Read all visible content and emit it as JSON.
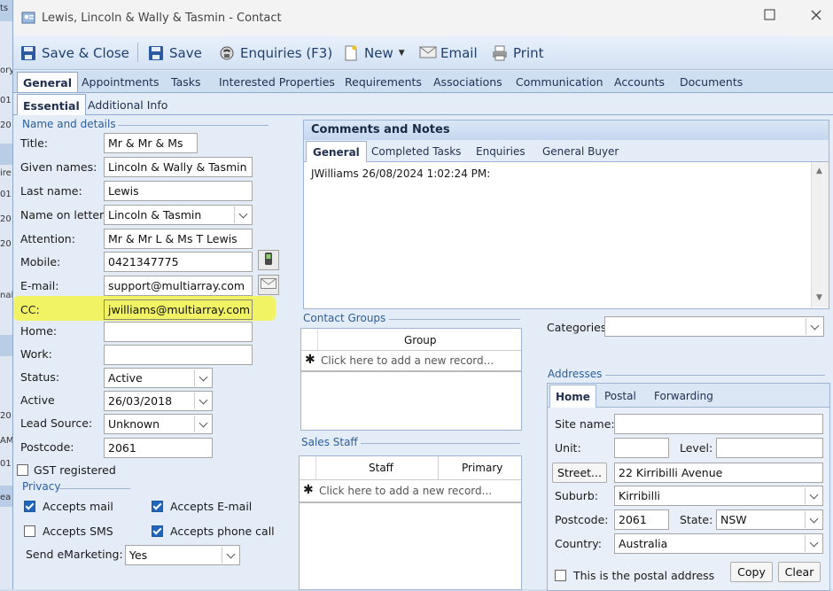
{
  "window": {
    "title": "Lewis, Lincoln & Wally & Tasmin - Contact"
  },
  "background": {
    "cells": [
      "ts",
      "ory",
      "01",
      "20",
      "ire",
      "01",
      "20",
      "20",
      "nal",
      "ea",
      "20",
      "AM",
      "01"
    ]
  },
  "toolbar": {
    "save_close": "Save & Close",
    "save": "Save",
    "enquiries": "Enquiries (F3)",
    "new": "New",
    "email": "Email",
    "print": "Print"
  },
  "tabs": [
    "General",
    "Appointments",
    "Tasks",
    "Interested Properties",
    "Requirements",
    "Associations",
    "Communication",
    "Accounts",
    "Documents"
  ],
  "subtabs": [
    "Essential",
    "Additional Info"
  ],
  "details": {
    "header": "Name and details",
    "title_label": "Title:",
    "title": "Mr & Mr & Ms",
    "given_label": "Given names:",
    "given": "Lincoln & Wally & Tasmin",
    "last_label": "Last name:",
    "last": "Lewis",
    "letters_label": "Name on letters:",
    "letters": "Lincoln & Tasmin",
    "attention_label": "Attention:",
    "attention": "Mr & Mr L & Ms T Lewis",
    "mobile_label": "Mobile:",
    "mobile": "0421347775",
    "email_label": "E-mail:",
    "email": "support@multiarray.com",
    "cc_label": "CC:",
    "cc": "jwilliams@multiarray.com",
    "home_label": "Home:",
    "home": "",
    "work_label": "Work:",
    "work": "",
    "status_label": "Status:",
    "status": "Active",
    "active_label": "Active",
    "active": "26/03/2018",
    "lead_label": "Lead Source:",
    "lead": "Unknown",
    "postcode_label": "Postcode:",
    "postcode": "2061",
    "gst_label": "GST registered"
  },
  "privacy": {
    "header": "Privacy",
    "mail": "Accepts mail",
    "email": "Accepts E-mail",
    "sms": "Accepts SMS",
    "phone": "Accepts phone call",
    "emarketing_label": "Send eMarketing:",
    "emarketing": "Yes"
  },
  "comments": {
    "header": "Comments and Notes",
    "tabs": [
      "General",
      "Completed Tasks",
      "Enquiries",
      "General Buyer"
    ],
    "text": "JWilliams 26/08/2024 1:02:24 PM:"
  },
  "contact_groups": {
    "header": "Contact Groups",
    "column": "Group",
    "new_row": "Click here to add a new record..."
  },
  "sales_staff": {
    "header": "Sales Staff",
    "col_staff": "Staff",
    "col_primary": "Primary",
    "new_row": "Click here to add a new record..."
  },
  "categories": {
    "label": "Categories:",
    "value": ""
  },
  "addresses": {
    "header": "Addresses",
    "tabs": [
      "Home",
      "Postal",
      "Forwarding"
    ],
    "site_label": "Site name:",
    "site": "",
    "unit_label": "Unit:",
    "unit": "",
    "level_label": "Level:",
    "level": "",
    "street_button": "Street...",
    "street": "22 Kirribilli Avenue",
    "suburb_label": "Suburb:",
    "suburb": "Kirribilli",
    "postcode_label": "Postcode:",
    "postcode": "2061",
    "state_label": "State:",
    "state": "NSW",
    "country_label": "Country:",
    "country": "Australia",
    "postal_label": "This is the postal address",
    "copy": "Copy",
    "clear": "Clear"
  },
  "colors": {
    "accent": "#2a5e9e",
    "highlight": "#f5f53c",
    "checkbox": "#2266bb"
  }
}
